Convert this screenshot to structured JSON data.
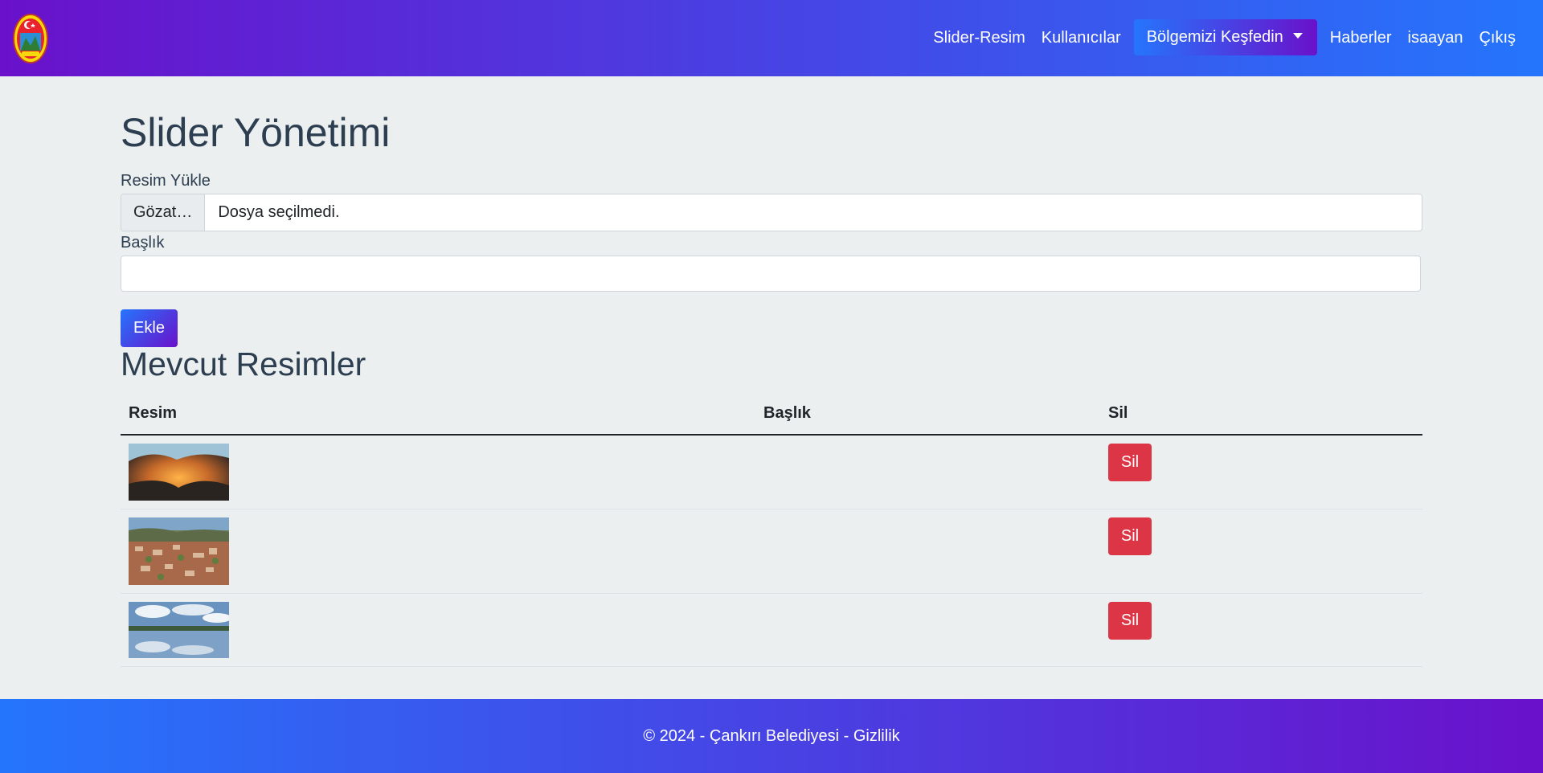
{
  "navbar": {
    "logo_icon": "cankiri-municipality-emblem",
    "items": {
      "slider": "Slider-Resim",
      "users": "Kullanıcılar",
      "explore": "Bölgemizi Keşfedin",
      "news": "Haberler",
      "user": "isaayan",
      "logout": "Çıkış"
    }
  },
  "main": {
    "title": "Slider Yönetimi",
    "upload_label": "Resim Yükle",
    "browse_label": "Gözat…",
    "file_status": "Dosya seçilmedi.",
    "caption_label": "Başlık",
    "caption_value": "",
    "add_label": "Ekle",
    "list_title": "Mevcut Resimler",
    "table": {
      "headers": [
        "Resim",
        "Başlık",
        "Sil"
      ],
      "rows": [
        {
          "image": "cave-interior-photo",
          "caption": "",
          "delete_label": "Sil"
        },
        {
          "image": "city-aerial-photo",
          "caption": "",
          "delete_label": "Sil"
        },
        {
          "image": "lake-reflection-photo",
          "caption": "",
          "delete_label": "Sil"
        }
      ]
    }
  },
  "footer": {
    "text": "© 2024 - Çankırı Belediyesi - Gizlilik"
  },
  "colors": {
    "gradient_start": "#6a11cb",
    "gradient_end": "#2575fc",
    "danger": "#dc3545",
    "background": "#ebeff0",
    "heading": "#2c3e50"
  }
}
